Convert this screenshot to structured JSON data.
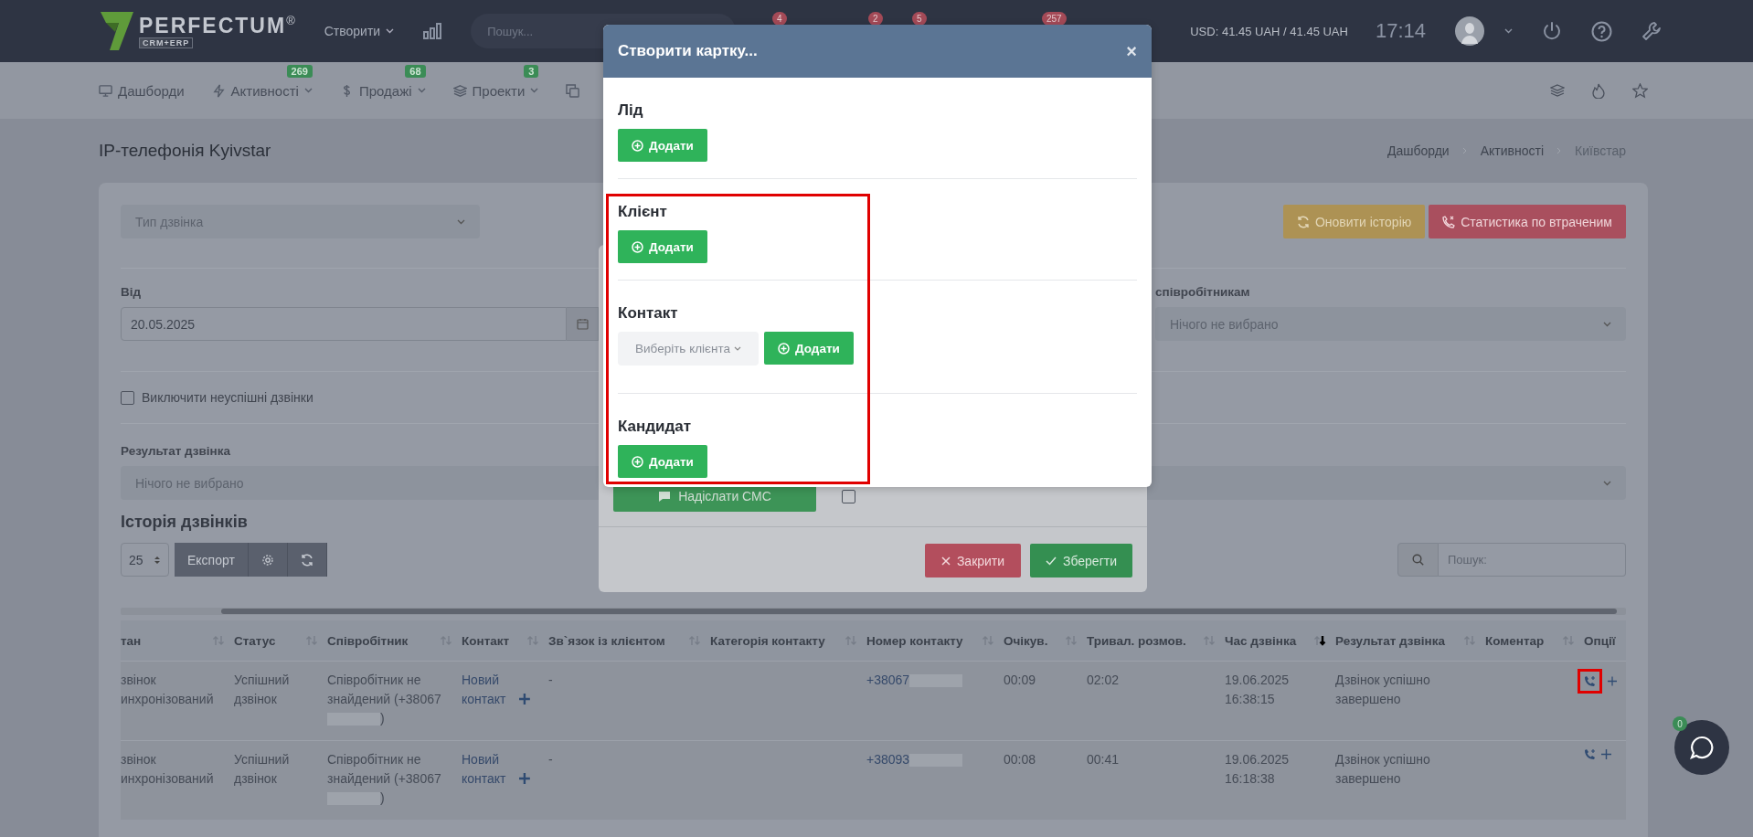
{
  "topbar": {
    "logo": "PERFECTUM",
    "logo_mark": "®",
    "logo_sub": "CRM+ERP",
    "create_menu": "Створити",
    "search": {
      "placeholder": "Пошук..."
    },
    "badges": [
      "4",
      "2",
      "5",
      "257"
    ],
    "currency": "USD: 41.45 UAH / 41.45 UAH",
    "time": "17:14"
  },
  "nav": {
    "items": [
      {
        "label": "Дашборди",
        "dropdown": false
      },
      {
        "label": "Активності",
        "badge": "269",
        "dropdown": true
      },
      {
        "label": "Продажі",
        "badge": "68",
        "dropdown": true
      },
      {
        "label": "Проекти",
        "badge": "3",
        "dropdown": true
      },
      {
        "dropdown": false
      }
    ]
  },
  "page": {
    "title": "IP-телефонія Kyivstar",
    "breadcrumbs": [
      {
        "label": "Дашборди",
        "current": false
      },
      {
        "label": "Активності",
        "current": false
      },
      {
        "label": "Київстар",
        "current": true
      }
    ]
  },
  "filters": {
    "call_type": {
      "placeholder": "Тип дзвінка"
    },
    "refresh_button": "Оновити історію",
    "lost_stats_button": "Статистика по втраченим",
    "from": {
      "label": "Від",
      "value": "20.05.2025"
    },
    "employees": {
      "label": "співробітникам",
      "placeholder": "Нічого не вибрано"
    },
    "exclude_failed": {
      "label": "Виключити неуспішні дзвінки",
      "checked": false
    },
    "result": {
      "label": "Результат дзвінка",
      "placeholder": "Нічого не вибрано"
    }
  },
  "history": {
    "title": "Історія дзвінків",
    "page_size": "25",
    "export_button": "Експорт",
    "search": {
      "placeholder": "Пошук:"
    }
  },
  "table": {
    "columns": [
      {
        "label": "тан",
        "sortable": true,
        "sorted": false
      },
      {
        "label": "Статус",
        "sortable": true,
        "sorted": false
      },
      {
        "label": "Співробітник",
        "sortable": true,
        "sorted": false
      },
      {
        "label": "Контакт",
        "sortable": true,
        "sorted": false
      },
      {
        "label": "Зв`язок із клієнтом",
        "sortable": true,
        "sorted": false
      },
      {
        "label": "Категорія контакту",
        "sortable": true,
        "sorted": false
      },
      {
        "label": "Номер контакту",
        "sortable": true,
        "sorted": false
      },
      {
        "label": "Очікув.",
        "sortable": true,
        "sorted": false
      },
      {
        "label": "Тривал. розмов.",
        "sortable": true,
        "sorted": false
      },
      {
        "label": "Час дзвінка",
        "sortable": true,
        "sorted": true
      },
      {
        "label": "Результат дзвінка",
        "sortable": true,
        "sorted": false
      },
      {
        "label": "Коментар",
        "sortable": true,
        "sorted": false
      },
      {
        "label": "Опції",
        "sortable": false,
        "sorted": false
      }
    ],
    "rows": [
      {
        "state": "звінок инхронізований",
        "status": "Успішний дзвінок",
        "employee": "Співробітник не знайдений (+38067",
        "employee_suffix": ")",
        "contact": "Новий контакт",
        "client_link": "-",
        "number": "+38067",
        "wait": "00:09",
        "duration": "02:02",
        "date": "19.06.2025",
        "time": "16:38:15",
        "result": "Дзвінок успішно завершено",
        "annotated": true
      },
      {
        "state": "звінок инхронізований",
        "status": "Успішний дзвінок",
        "employee": "Співробітник не знайдений (+38067",
        "employee_suffix": ")",
        "contact": "Новий контакт",
        "client_link": "-",
        "number": "+38093",
        "wait": "00:08",
        "duration": "00:41",
        "date": "19.06.2025",
        "time": "16:18:38",
        "result": "Дзвінок успішно завершено",
        "annotated": false
      }
    ]
  },
  "back_modal": {
    "sms_button": "Надіслати СМС",
    "checkbox": {
      "checked": false
    },
    "close_button": "Закрити",
    "save_button": "Зберегти"
  },
  "modal": {
    "title": "Створити картку...",
    "close": "×",
    "sections": [
      {
        "kind": "add",
        "title": "Лід",
        "button": "Додати",
        "highlighted": false
      },
      {
        "kind": "add",
        "title": "Клієнт",
        "button": "Додати",
        "highlighted": true
      },
      {
        "kind": "select_add",
        "title": "Контакт",
        "select_placeholder": "Виберіть клієнта",
        "button": "Додати",
        "highlighted": true
      },
      {
        "kind": "add",
        "title": "Кандидат",
        "button": "Додати",
        "highlighted": true
      }
    ]
  },
  "chat": {
    "badge": "0"
  }
}
